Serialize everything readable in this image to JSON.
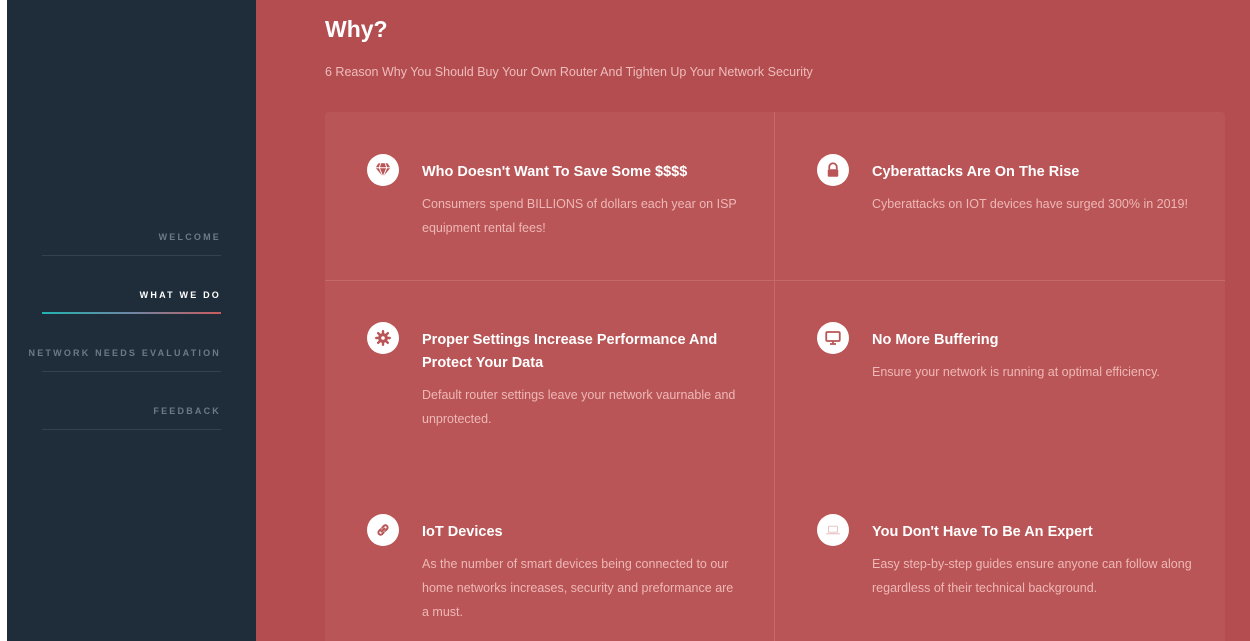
{
  "sidebar": {
    "items": [
      {
        "label": "WELCOME",
        "active": false
      },
      {
        "label": "WHAT WE DO",
        "active": true
      },
      {
        "label": "NETWORK NEEDS EVALUATION",
        "active": false
      },
      {
        "label": "FEEDBACK",
        "active": false
      }
    ]
  },
  "main": {
    "title": "Why?",
    "subtitle": "6 Reason Why You Should Buy Your Own Router And Tighten Up Your Network Security",
    "cards": [
      {
        "icon": "diamond-icon",
        "title": "Who Doesn't Want To Save Some $$$$",
        "text": "Consumers spend BILLIONS of dollars each year on ISP equipment rental fees!"
      },
      {
        "icon": "lock-icon",
        "title": "Cyberattacks Are On The Rise",
        "text": "Cyberattacks on IOT devices have surged 300% in 2019!"
      },
      {
        "icon": "gear-icon",
        "title": "Proper Settings Increase Performance And Protect Your Data",
        "text": "Default router settings leave your network vaurnable and unprotected."
      },
      {
        "icon": "monitor-icon",
        "title": "No More Buffering",
        "text": "Ensure your network is running at optimal efficiency."
      },
      {
        "icon": "link-icon",
        "title": "IoT Devices",
        "text": "As the number of smart devices being connected to our home networks increases, security and preformance are a must."
      },
      {
        "icon": "laptop-icon",
        "title": "You Don't Have To Be An Expert",
        "text": "Easy step-by-step guides ensure anyone can follow along regardless of their technical background."
      }
    ]
  },
  "colors": {
    "sidebar_bg": "#1f2d3b",
    "main_bg": "#b34d4f",
    "card_bg": "#b95556",
    "nav_accent_start": "#22b3b0",
    "nav_accent_end": "#c95d5d"
  }
}
